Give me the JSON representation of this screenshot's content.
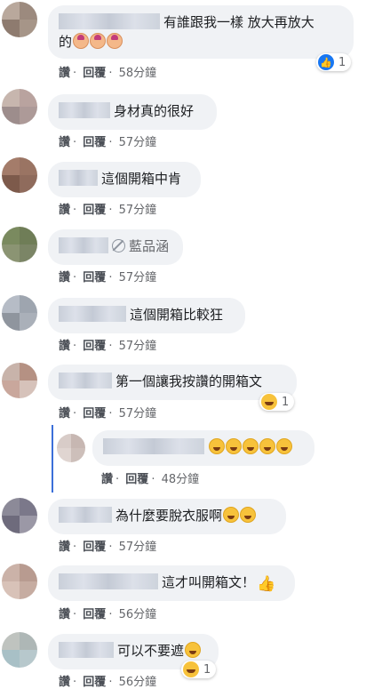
{
  "actions": {
    "like": "讚",
    "reply": "回覆",
    "sep": "·"
  },
  "comments": [
    {
      "text_line1": "有誰跟我一樣 放大再放大",
      "text_line2": "的",
      "time": "58分鐘",
      "reaction_count": "1",
      "reaction_type": "like-icon",
      "emojis": [
        "person-gesturing-ok-icon",
        "person-gesturing-ok-icon",
        "person-gesturing-ok-icon"
      ]
    },
    {
      "text": "身材真的很好",
      "time": "57分鐘"
    },
    {
      "text": "這個開箱中肯",
      "time": "57分鐘"
    },
    {
      "text": "藍品涵",
      "time": "57分鐘"
    },
    {
      "text": "這個開箱比較狂",
      "time": "57分鐘"
    },
    {
      "text": "第一個讓我按讚的開箱文",
      "time": "57分鐘",
      "reaction_count": "1",
      "reaction_type": "haha-icon"
    },
    {
      "reply": true,
      "time": "48分鐘",
      "emojis": [
        "grinning-icon",
        "grinning-icon",
        "grinning-icon",
        "grinning-icon",
        "grinning-icon"
      ]
    },
    {
      "text": "為什麼要脫衣服啊",
      "time": "57分鐘",
      "emojis": [
        "tears-of-joy-icon",
        "tears-of-joy-icon"
      ]
    },
    {
      "text": "這才叫開箱文！",
      "time": "56分鐘",
      "emojis": [
        "thumbs-up-icon"
      ]
    },
    {
      "text": "可以不要遮",
      "time": "56分鐘",
      "reaction_count": "1",
      "reaction_type": "haha-icon",
      "emojis": [
        "tears-of-joy-icon"
      ]
    }
  ],
  "colors": {
    "bubble": "#f0f2f5",
    "meta": "#65676b",
    "like_blue": "#1877f2",
    "thread_line": "#3b6fd9"
  }
}
